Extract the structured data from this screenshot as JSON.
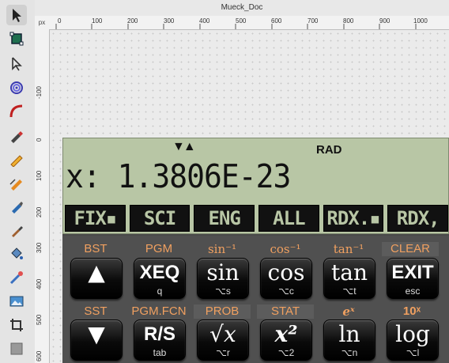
{
  "window": {
    "title": "Mueck_Doc"
  },
  "ruler": {
    "unit": "px",
    "h_labels": [
      "0",
      "100",
      "200",
      "300",
      "400",
      "500",
      "600",
      "700",
      "800",
      "900",
      "1000"
    ],
    "v_labels": [
      "-100",
      "0",
      "100",
      "200",
      "300",
      "400",
      "500",
      "600"
    ]
  },
  "toolbar": {
    "tools": [
      {
        "icon": "selector-arrow-icon"
      },
      {
        "icon": "node-select-icon"
      },
      {
        "icon": "pointer-arrow-icon"
      },
      {
        "icon": "spiral-icon"
      },
      {
        "icon": "arc-tool-icon"
      },
      {
        "icon": "pen-icon"
      },
      {
        "icon": "pencil-icon"
      },
      {
        "icon": "calligraphy-icon"
      },
      {
        "icon": "brush-icon"
      },
      {
        "icon": "dropper-icon"
      },
      {
        "icon": "paint-bucket-icon"
      },
      {
        "icon": "tweak-icon"
      },
      {
        "icon": "image-icon"
      },
      {
        "icon": "crop-icon"
      },
      {
        "icon": "rectangle-icon"
      }
    ]
  },
  "calculator": {
    "flags": "▼▲",
    "angle_mode": "RAD",
    "display_line": "x: 1.3806E-23",
    "menu": [
      "FIX▪",
      "SCI",
      "ENG",
      "ALL",
      "RDX.▪",
      "RDX,"
    ],
    "row1_shift": [
      "BST",
      "PGM",
      "sin⁻¹",
      "cos⁻¹",
      "tan⁻¹",
      "CLEAR"
    ],
    "row1_keys": [
      {
        "main": "▲",
        "sub": ""
      },
      {
        "main": "XEQ",
        "sub": "q"
      },
      {
        "main": "sin",
        "sub": "⌥s"
      },
      {
        "main": "cos",
        "sub": "⌥c"
      },
      {
        "main": "tan",
        "sub": "⌥t"
      },
      {
        "main": "EXIT",
        "sub": "esc"
      }
    ],
    "row2_shift": [
      "SST",
      "PGM.FCN",
      "PROB",
      "STAT",
      "eˣ",
      "10ˣ"
    ],
    "row2_keys": [
      {
        "main": "▼",
        "sub": ""
      },
      {
        "main": "R/S",
        "sub": "tab"
      },
      {
        "main": "√x",
        "sub": "⌥r"
      },
      {
        "main": "x²",
        "sub": "⌥2"
      },
      {
        "main": "ln",
        "sub": "⌥n"
      },
      {
        "main": "log",
        "sub": "⌥l"
      }
    ]
  },
  "colors": {
    "lcd": "#b8c6a5",
    "shift_label": "#f0a060",
    "key": "#0a0a0a"
  }
}
